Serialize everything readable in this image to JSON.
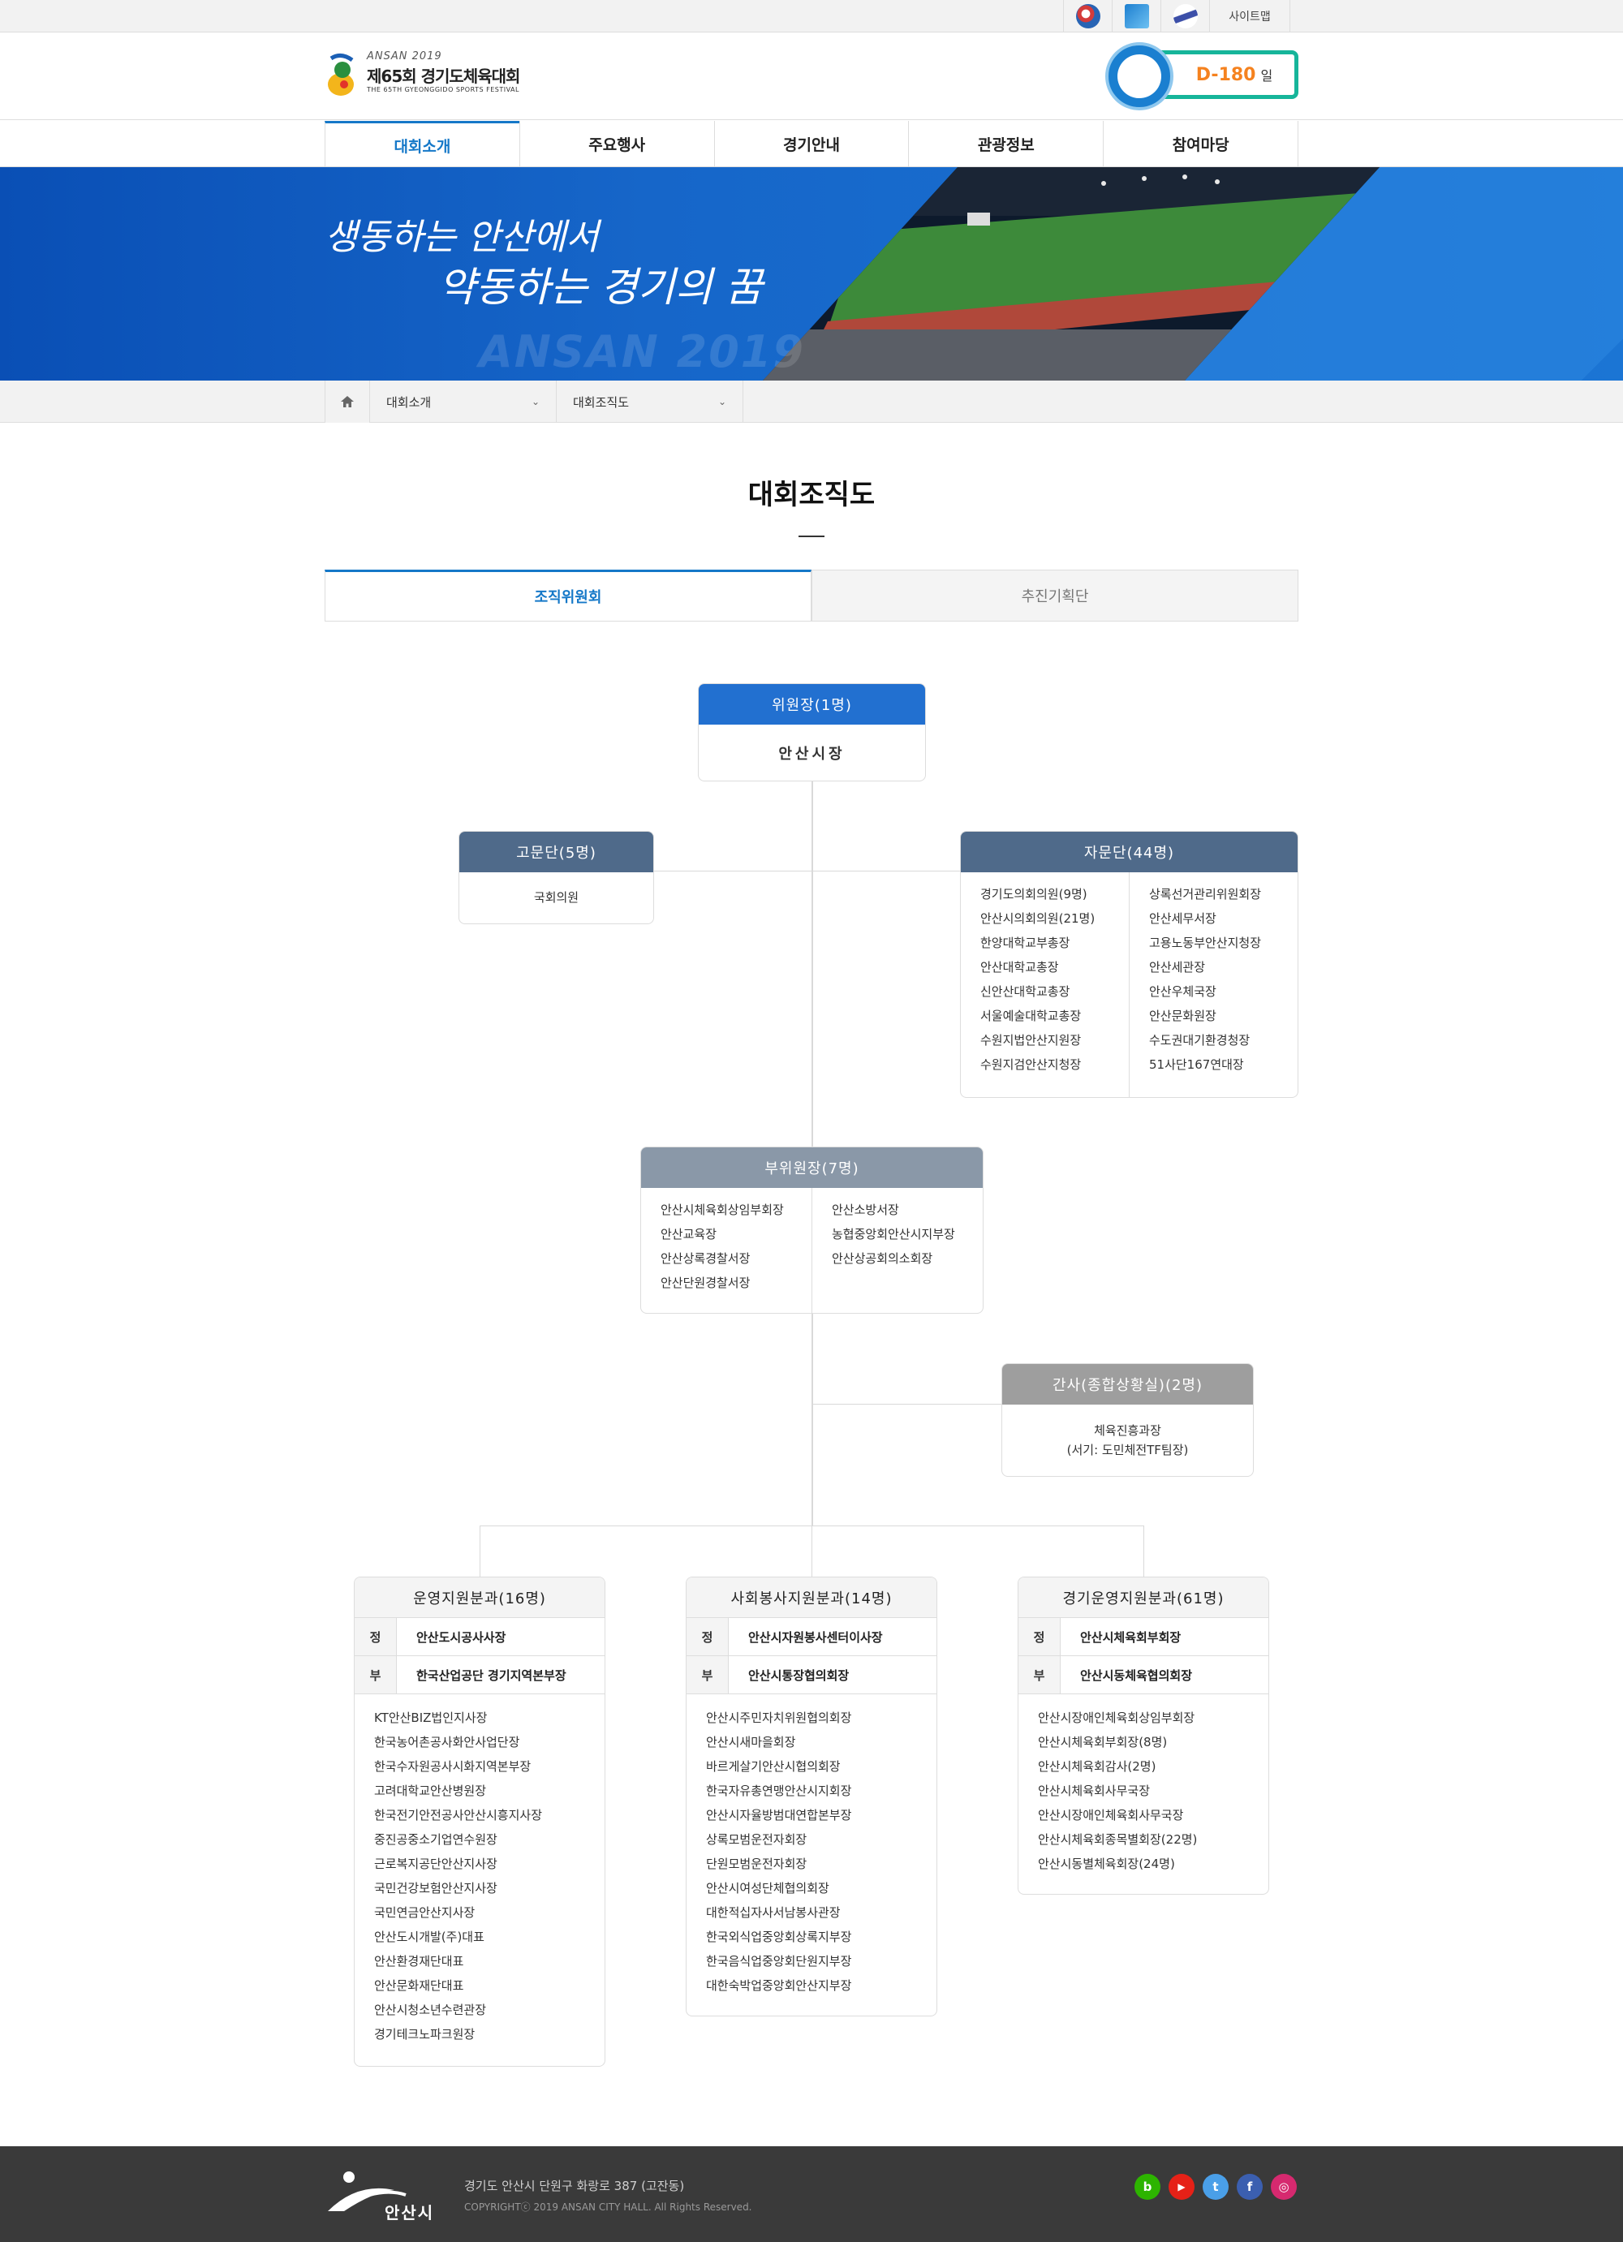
{
  "util": {
    "sitemap": "사이트맵"
  },
  "header": {
    "logo_top": "ANSAN 2019",
    "logo_title": "제65회 경기도체육대회",
    "logo_sub": "THE 65TH GYEONGGIDO SPORTS FESTIVAL",
    "dday_num": "D-180",
    "dday_unit": "일"
  },
  "nav": {
    "items": [
      "대회소개",
      "주요행사",
      "경기안내",
      "관광정보",
      "참여마당"
    ],
    "active": 0
  },
  "banner": {
    "line1": "생동하는 안산에서",
    "line2": "약동하는 경기의 꿈",
    "watermark": "ANSAN 2019"
  },
  "breadcrumb": {
    "level1": "대회소개",
    "level2": "대회조직도"
  },
  "page": {
    "title": "대회조직도"
  },
  "tabs": {
    "on": "조직위원회",
    "off": "추진기획단"
  },
  "org": {
    "chair": {
      "head": "위원장(1명)",
      "name": "안산시장"
    },
    "advisors": {
      "head": "고문단(5명)",
      "items": [
        "국회의원"
      ]
    },
    "consult": {
      "head": "자문단(44명)",
      "left": [
        "경기도의회의원(9명)",
        "안산시의회의원(21명)",
        "한양대학교부총장",
        "안산대학교총장",
        "신안산대학교총장",
        "서울예술대학교총장",
        "수원지법안산지원장",
        "수원지검안산지청장"
      ],
      "right": [
        "상록선거관리위원회장",
        "안산세무서장",
        "고용노동부안산지청장",
        "안산세관장",
        "안산우체국장",
        "안산문화원장",
        "수도권대기환경청장",
        "51사단167연대장"
      ]
    },
    "vice": {
      "head": "부위원장(7명)",
      "left": [
        "안산시체육회상임부회장",
        "안산교육장",
        "안산상록경찰서장",
        "안산단원경찰서장"
      ],
      "right": [
        "안산소방서장",
        "농협중앙회안산시지부장",
        "안산상공회의소회장"
      ]
    },
    "secretary": {
      "head": "간사(종합상황실)(2명)",
      "line1": "체육진흥과장",
      "line2": "(서기: 도민체전TF팀장)"
    },
    "committees": [
      {
        "head": "운영지원분과(16명)",
        "chief": "안산도시공사사장",
        "deputy": "한국산업공단 경기지역본부장",
        "items": [
          "KT안산BIZ법인지사장",
          "한국농어촌공사화안사업단장",
          "한국수자원공사시화지역본부장",
          "고려대학교안산병원장",
          "한국전기안전공사안산시흥지사장",
          "중진공중소기업연수원장",
          "근로복지공단안산지사장",
          "국민건강보험안산지사장",
          "국민연금안산지사장",
          "안산도시개발(주)대표",
          "안산환경재단대표",
          "안산문화재단대표",
          "안산시청소년수련관장",
          "경기테크노파크원장"
        ]
      },
      {
        "head": "사회봉사지원분과(14명)",
        "chief": "안산시자원봉사센터이사장",
        "deputy": "안산시통장협의회장",
        "items": [
          "안산시주민자치위원협의회장",
          "안산시새마을회장",
          "바르게살기안산시협의회장",
          "한국자유총연맹안산시지회장",
          "안산시자율방범대연합본부장",
          "상록모범운전자회장",
          "단원모범운전자회장",
          "안산시여성단체협의회장",
          "대한적십자사서남봉사관장",
          "한국외식업중앙회상록지부장",
          "한국음식업중앙회단원지부장",
          "대한숙박업중앙회안산지부장"
        ]
      },
      {
        "head": "경기운영지원분과(61명)",
        "chief": "안산시체육회부회장",
        "deputy": "안산시동체육협의회장",
        "items": [
          "안산시장애인체육회상임부회장",
          "안산시체육회부회장(8명)",
          "안산시체육회감사(2명)",
          "안산시체육회사무국장",
          "안산시장애인체육회사무국장",
          "안산시체육회종목별회장(22명)",
          "안산시동별체육회장(24명)"
        ]
      }
    ],
    "chief_key": "정",
    "deputy_key": "부"
  },
  "footer": {
    "logo": "안산시",
    "address": "경기도 안산시 단원구 화랑로 387 (고잔동)",
    "copyright": "COPYRIGHTⓒ 2019 ANSAN CITY HALL. All Rights Reserved.",
    "sns": [
      {
        "name": "blog",
        "label": "b",
        "color": "#2db400"
      },
      {
        "name": "youtube",
        "label": "▶",
        "color": "#e62117"
      },
      {
        "name": "twitter",
        "label": "t",
        "color": "#4a9fe8"
      },
      {
        "name": "facebook",
        "label": "f",
        "color": "#3b5fb0"
      },
      {
        "name": "instagram",
        "label": "◎",
        "color": "#d6296f"
      }
    ]
  }
}
